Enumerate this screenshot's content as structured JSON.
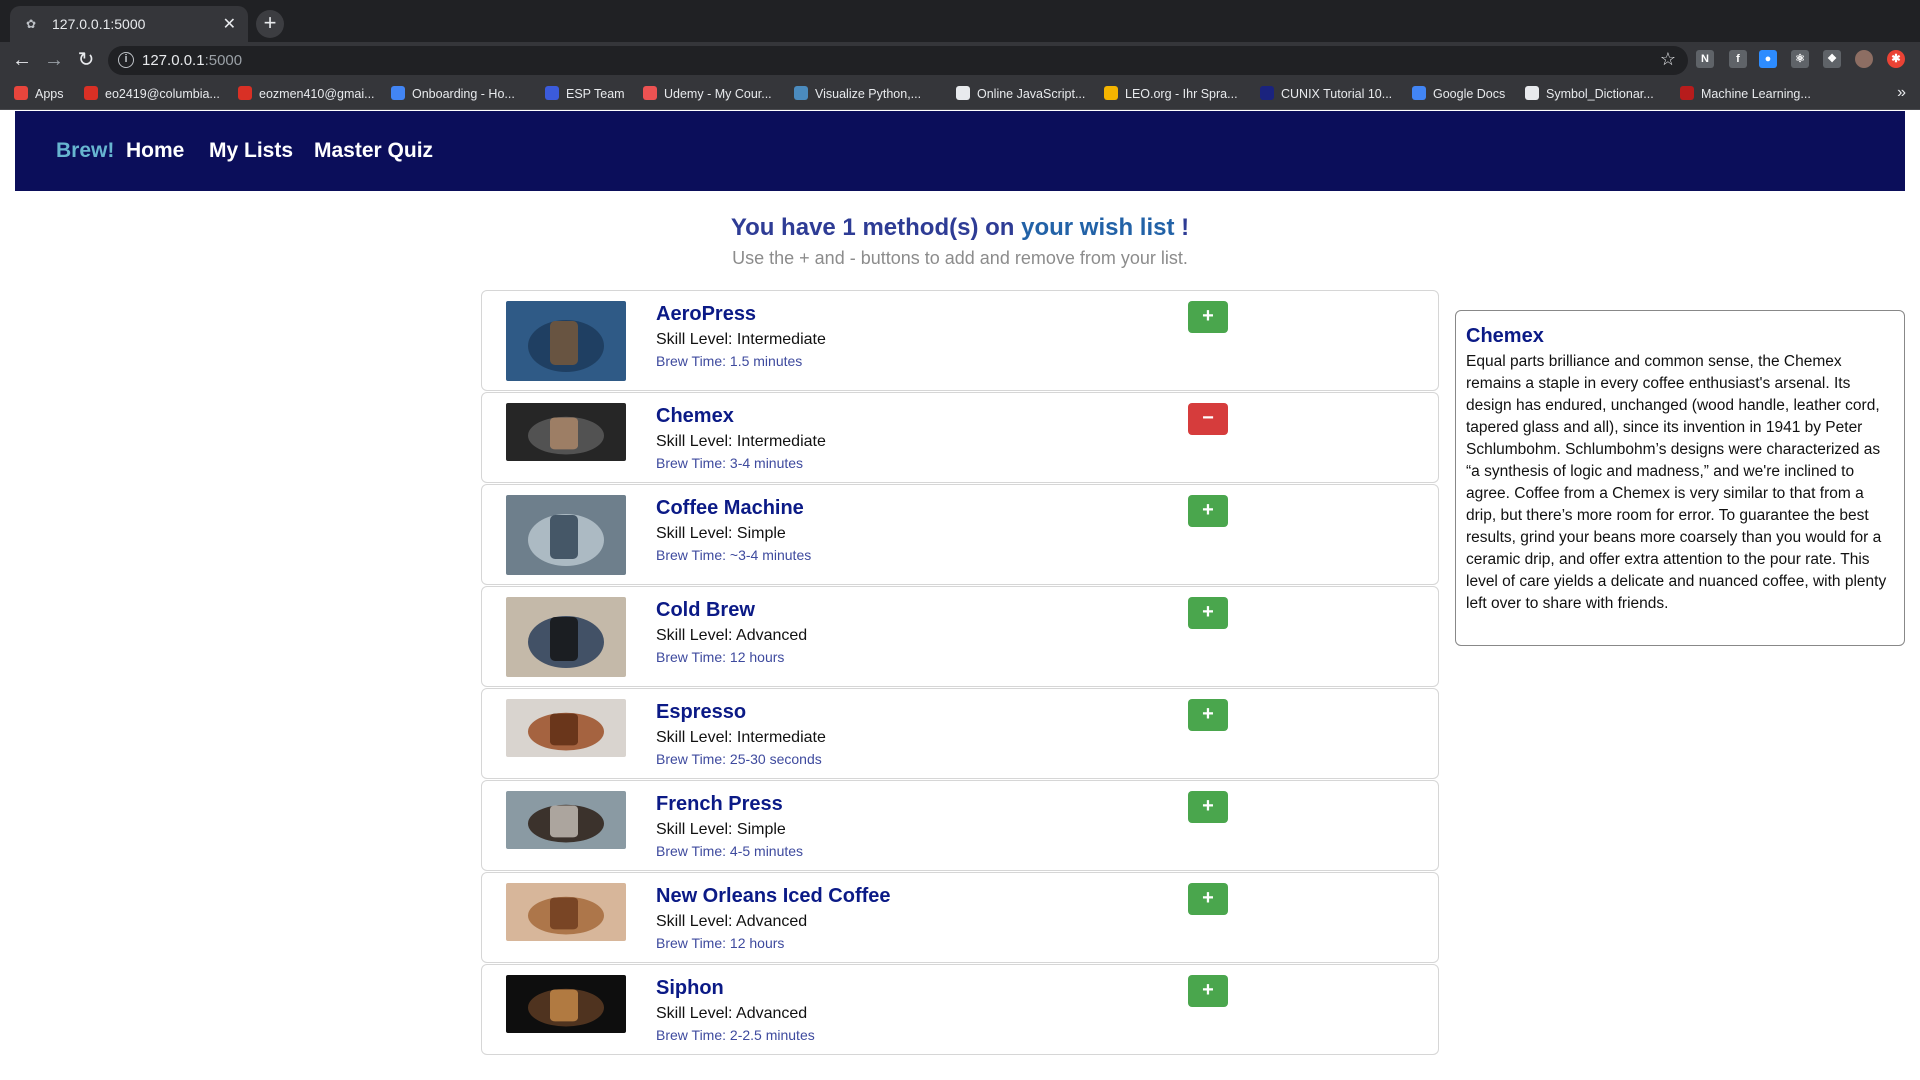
{
  "browser": {
    "tab_title": "127.0.0.1:5000",
    "url_host": "127.0.0.1",
    "url_port": ":5000",
    "bookmarks": [
      {
        "label": "Apps",
        "color": "#e8453c"
      },
      {
        "label": "eo2419@columbia...",
        "color": "#d93025"
      },
      {
        "label": "eozmen410@gmai...",
        "color": "#d93025"
      },
      {
        "label": "Onboarding - Ho...",
        "color": "#4285f4"
      },
      {
        "label": "ESP Team",
        "color": "#3b5bdb"
      },
      {
        "label": "Udemy - My Cour...",
        "color": "#ec5252"
      },
      {
        "label": "Visualize Python,...",
        "color": "#4b8bbe"
      },
      {
        "label": "Online JavaScript...",
        "color": "#e8eaed"
      },
      {
        "label": "LEO.org - Ihr Spra...",
        "color": "#f4b400"
      },
      {
        "label": "CUNIX Tutorial 10...",
        "color": "#1a237e"
      },
      {
        "label": "Google Docs",
        "color": "#4285f4"
      },
      {
        "label": "Symbol_Dictionar...",
        "color": "#e8eaed"
      },
      {
        "label": "Machine Learning...",
        "color": "#b71c1c"
      }
    ]
  },
  "nav": {
    "brand": "Brew!",
    "links": [
      "Home",
      "My Lists",
      "Master Quiz"
    ]
  },
  "heading": {
    "part1": "You have 1 method(s) on ",
    "part2": "your wish list",
    "part3": " !",
    "subtitle": "Use the + and - buttons to add and remove from your list."
  },
  "methods": [
    {
      "name": "AeroPress",
      "skill": "Skill Level: Intermediate",
      "time": "Brew Time: 1.5 minutes",
      "action": "+",
      "in_list": false
    },
    {
      "name": "Chemex",
      "skill": "Skill Level: Intermediate",
      "time": "Brew Time: 3-4 minutes",
      "action": "−",
      "in_list": true
    },
    {
      "name": "Coffee Machine",
      "skill": "Skill Level: Simple",
      "time": "Brew Time: ~3-4 minutes",
      "action": "+",
      "in_list": false
    },
    {
      "name": "Cold Brew",
      "skill": "Skill Level: Advanced",
      "time": "Brew Time: 12 hours",
      "action": "+",
      "in_list": false
    },
    {
      "name": "Espresso",
      "skill": "Skill Level: Intermediate",
      "time": "Brew Time: 25-30 seconds",
      "action": "+",
      "in_list": false
    },
    {
      "name": "French Press",
      "skill": "Skill Level: Simple",
      "time": "Brew Time: 4-5 minutes",
      "action": "+",
      "in_list": false
    },
    {
      "name": "New Orleans Iced Coffee",
      "skill": "Skill Level: Advanced",
      "time": "Brew Time: 12 hours",
      "action": "+",
      "in_list": false
    },
    {
      "name": "Siphon",
      "skill": "Skill Level: Advanced",
      "time": "Brew Time: 2-2.5 minutes",
      "action": "+",
      "in_list": false
    }
  ],
  "detail": {
    "title": "Chemex",
    "text": "Equal parts brilliance and common sense, the Chemex remains a staple in every coffee enthusiast's arsenal. Its design has endured, unchanged (wood handle, leather cord, tapered glass and all), since its invention in 1941 by Peter Schlumbohm. Schlumbohm’s designs were characterized as “a synthesis of logic and madness,” and we're inclined to agree. Coffee from a Chemex is very similar to that from a drip, but there’s more room for error. To guarantee the best results, grind your beans more coarsely than you would for a ceramic drip, and offer extra attention to the pour rate. This level of care yields a delicate and nuanced coffee, with plenty left over to share with friends."
  },
  "colors": {
    "navbar": "#0b0e5a",
    "brand": "#67b5d0",
    "add_button": "#4aa64d",
    "remove_button": "#d63c3c",
    "method_name": "#0b1a86"
  }
}
